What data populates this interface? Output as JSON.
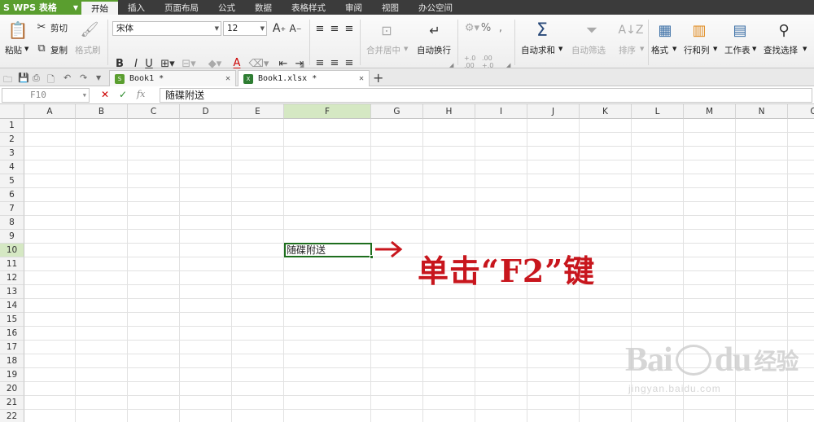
{
  "app": {
    "logo": "S",
    "name": "WPS 表格"
  },
  "menu_tabs": [
    "开始",
    "插入",
    "页面布局",
    "公式",
    "数据",
    "表格样式",
    "审阅",
    "视图",
    "办公空间"
  ],
  "ribbon": {
    "paste": "粘贴",
    "cut": "剪切",
    "copy": "复制",
    "format_painter": "格式刷",
    "font_name": "宋体",
    "font_size": "12",
    "bold": "B",
    "italic": "I",
    "underline": "U",
    "font_color_letter": "A",
    "merge_center": "合并居中",
    "wrap_text": "自动换行",
    "percent": "%",
    "thousands": ",",
    "dec_inc": "+.0 .00",
    "dec_dec": ".00 +.0",
    "autosum": "自动求和",
    "autofilter": "自动筛选",
    "sort": "排序",
    "format": "格式",
    "rows_cols": "行和列",
    "worksheet": "工作表",
    "find_select": "查找选择"
  },
  "doc_tabs": [
    {
      "name": "Book1 *",
      "active": false
    },
    {
      "name": "Book1.xlsx *",
      "active": true
    }
  ],
  "formula_bar": {
    "cell_ref": "F10",
    "fx": "fx",
    "content": "随碟附送"
  },
  "columns": [
    "A",
    "B",
    "C",
    "D",
    "E",
    "F",
    "G",
    "H",
    "I",
    "J",
    "K",
    "L",
    "M",
    "N",
    "O"
  ],
  "rows": [
    "1",
    "2",
    "3",
    "4",
    "5",
    "6",
    "7",
    "8",
    "9",
    "10",
    "11",
    "12",
    "13",
    "14",
    "15",
    "16",
    "17",
    "18",
    "19",
    "20",
    "21",
    "22"
  ],
  "selected_column": "F",
  "selected_row": "10",
  "active_cell_value": "随碟附送",
  "annotation": {
    "text": "单击“F2”键",
    "color": "#c8161d"
  },
  "watermark": {
    "brand": "Bai",
    "brand2": "du",
    "suffix": "经验",
    "url": "jingyan.baidu.com"
  },
  "colors": {
    "brand_green": "#5a9e2f",
    "selection_header": "#d5e8c3",
    "active_border": "#1e6e1e"
  }
}
